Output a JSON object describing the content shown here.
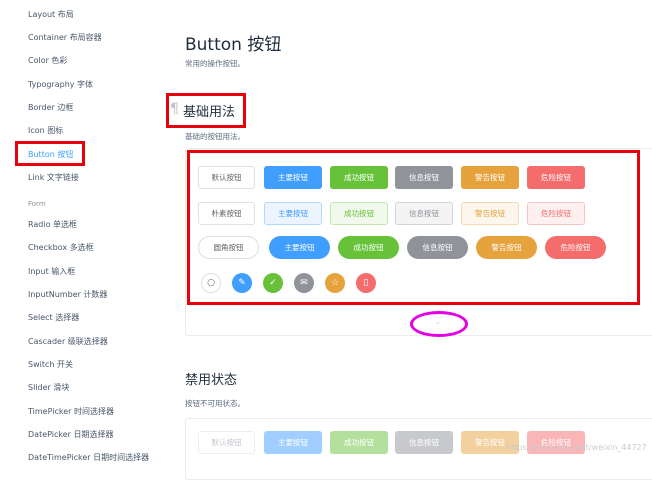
{
  "sidebar": {
    "items": [
      {
        "label": "Layout 布局"
      },
      {
        "label": "Container 布局容器"
      },
      {
        "label": "Color 色彩"
      },
      {
        "label": "Typography 字体"
      },
      {
        "label": "Border 边框"
      },
      {
        "label": "Icon 图标"
      },
      {
        "label": "Button 按钮",
        "active": true
      },
      {
        "label": "Link 文字链接"
      }
    ],
    "group_label": "Form",
    "form_items": [
      {
        "label": "Radio 单选框"
      },
      {
        "label": "Checkbox 多选框"
      },
      {
        "label": "Input 输入框"
      },
      {
        "label": "InputNumber 计数器"
      },
      {
        "label": "Select 选择器"
      },
      {
        "label": "Cascader 级联选择器"
      },
      {
        "label": "Switch 开关"
      },
      {
        "label": "Slider 滑块"
      },
      {
        "label": "TimePicker 时间选择器"
      },
      {
        "label": "DatePicker 日期选择器"
      },
      {
        "label": "DateTimePicker 日期时间选择器"
      }
    ]
  },
  "main": {
    "title": "Button 按钮",
    "description": "常用的操作按钮。",
    "basic": {
      "anchor": "¶",
      "title": "基础用法",
      "description": "基础的按钮用法。",
      "rows": {
        "default": [
          "默认按钮",
          "主要按钮",
          "成功按钮",
          "信息按钮",
          "警告按钮",
          "危险按钮"
        ],
        "plain": [
          "朴素按钮",
          "主要按钮",
          "成功按钮",
          "信息按钮",
          "警告按钮",
          "危险按钮"
        ],
        "round": [
          "圆角按钮",
          "主要按钮",
          "成功按钮",
          "信息按钮",
          "警告按钮",
          "危险按钮"
        ]
      },
      "circle_icons": [
        "search-icon",
        "edit-icon",
        "check-icon",
        "message-icon",
        "star-icon",
        "delete-icon"
      ],
      "circle_glyphs": [
        "○",
        "✎",
        "✓",
        "✉",
        "☆",
        "▯"
      ],
      "toggle_glyph": "⌄"
    },
    "disabled": {
      "title": "禁用状态",
      "description": "按钮不可用状态。",
      "buttons": [
        "默认按钮",
        "主要按钮",
        "成功按钮",
        "信息按钮",
        "警告按钮",
        "危险按钮"
      ]
    }
  },
  "watermark": "https://blog.csdn.net/weixin_44727",
  "colors": {
    "primary": "#409eff",
    "success": "#67c23a",
    "info": "#909399",
    "warning": "#e6a23c",
    "danger": "#f56c6c",
    "annotation_red": "#e8000d",
    "annotation_magenta": "#e500e5"
  }
}
